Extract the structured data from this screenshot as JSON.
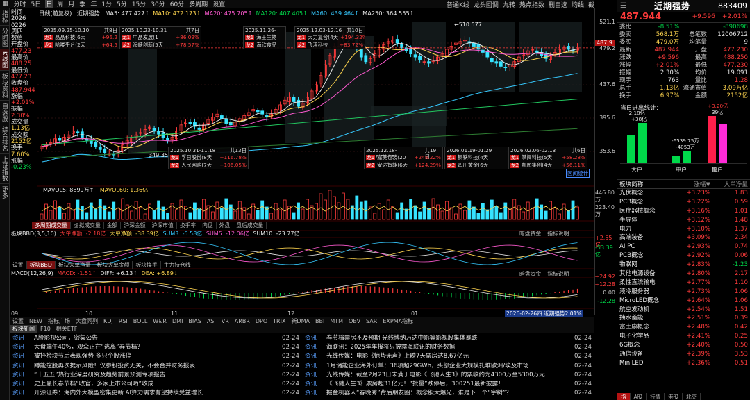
{
  "toolbar": {
    "items": [
      "分时",
      "5日",
      "日",
      "周",
      "月",
      "季",
      "年",
      "1分",
      "5分",
      "15分",
      "30分",
      "60分",
      "多周期",
      "设置"
    ],
    "selected_index": 2,
    "right_items": [
      "普通K线",
      "龙头回调",
      "九转",
      "热点指数",
      "删自选",
      "均线",
      "截"
    ]
  },
  "sidebar": [
    "指标",
    "分时图",
    "K线图",
    "板块资料",
    "自选股",
    "综合排名",
    "上证指数",
    "更多"
  ],
  "sidebar_selected": 2,
  "datacol": [
    {
      "t": "时间",
      "c": "wht"
    },
    {
      "t": "2026",
      "c": "wht"
    },
    {
      "t": "0226",
      "c": "wht"
    },
    {
      "t": "周四",
      "c": "wht"
    },
    {
      "t": "数值",
      "c": "wht"
    },
    {
      "t": "开盘价",
      "c": "wht"
    },
    {
      "t": "477.23",
      "c": "red"
    },
    {
      "t": "最高价",
      "c": "wht"
    },
    {
      "t": "488.25",
      "c": "red"
    },
    {
      "t": "最低价",
      "c": "wht"
    },
    {
      "t": "477.23",
      "c": "red"
    },
    {
      "t": "收盘价",
      "c": "wht"
    },
    {
      "t": "487.944",
      "c": "red"
    },
    {
      "t": "涨幅",
      "c": "wht"
    },
    {
      "t": "+2.01%",
      "c": "red"
    },
    {
      "t": "振幅",
      "c": "wht"
    },
    {
      "t": "2.30%",
      "c": "red"
    },
    {
      "t": "成交量",
      "c": "wht"
    },
    {
      "t": "1.13亿",
      "c": "yel"
    },
    {
      "t": "成交额",
      "c": "wht"
    },
    {
      "t": "2152亿",
      "c": "yel"
    },
    {
      "t": "换手",
      "c": "wht"
    },
    {
      "t": "7.60%",
      "c": "yel"
    },
    {
      "t": "涨幅",
      "c": "wht"
    },
    {
      "t": "-0.23%",
      "c": "grn"
    }
  ],
  "ma_header": {
    "name": "日线(前复权)",
    "stock": "近期强势",
    "items": [
      {
        "t": "MA5: 477.427↑",
        "c": "wht"
      },
      {
        "t": "MA10: 472.173↑",
        "c": "yel"
      },
      {
        "t": "MA20: 475.705↑",
        "c": "mag"
      },
      {
        "t": "MA120: 407.405↑",
        "c": "grn"
      },
      {
        "t": "MA60: 439.464↑",
        "c": "cyn"
      },
      {
        "t": "MA250: 364.555↑",
        "c": "wht"
      }
    ]
  },
  "price_scale": [
    "521.1",
    "487.9",
    "479.2",
    "437.6",
    "395.6",
    "353.6",
    "446.80万",
    "223.40万",
    "+2.55亿",
    "-53.39亿",
    "+24.92",
    "+12.28",
    "0.00",
    "-12.28"
  ],
  "current_price_tag": "487.9",
  "chart_annotations": {
    "high": "510.577",
    "low": "349.35"
  },
  "events": [
    {
      "period": "2025.09.25-10.10",
      "days": "共8日",
      "rows": [
        {
          "n": "晶晶科技(6天",
          "p": "+96.2"
        },
        {
          "n": "哈喽平台(2天",
          "p": "+64.5"
        }
      ]
    },
    {
      "period": "2025.10.23-10.31",
      "days": "共7日",
      "rows": [
        {
          "n": "中晶发展(1",
          "p": "+86.09%"
        },
        {
          "n": "海峡创新(5天",
          "p": "+78.57%"
        }
      ]
    },
    {
      "period": "2025.11.26-12.0",
      "days": "",
      "rows": [
        {
          "n": "海王生物",
          "p": ""
        },
        {
          "n": "海欣食品",
          "p": ""
        }
      ]
    },
    {
      "period": "2025.12.03-12.16",
      "days": "共10日",
      "rows": [
        {
          "n": "天力复合(4天",
          "p": "+194.32%"
        },
        {
          "n": "飞沃科技",
          "p": "+83.72%"
        }
      ]
    },
    {
      "period": "2025.10.31-11.18",
      "days": "共13日",
      "rows": [
        {
          "n": "孚日股份(8天",
          "p": "+116.78%"
        },
        {
          "n": "人民网购(7天",
          "p": "+106.05%"
        }
      ]
    },
    {
      "period": "2025.12.18-2026.01.15",
      "days": "共19日",
      "rows": [
        {
          "n": "嘉美包装(20",
          "p": "+248.22%"
        },
        {
          "n": "安达智能(6天",
          "p": "+124.29%"
        }
      ]
    },
    {
      "period": "2026.01.19-01.29",
      "days": "",
      "rows": [
        {
          "n": "钢铁科技(4天",
          "p": ""
        },
        {
          "n": "四川黄金(6天",
          "p": ""
        }
      ]
    },
    {
      "period": "2026.02.06-02.13",
      "days": "共6日",
      "rows": [
        {
          "n": "掌阅科技(5天",
          "p": "+58.28%"
        },
        {
          "n": "凯图集创(4天",
          "p": "+56.11%"
        }
      ]
    }
  ],
  "zone_label": "区间统计",
  "vol_header": {
    "name": "MAVOL5: 8899万↑",
    "ma": "MAVOL60: 1.36亿"
  },
  "vol_tabs": [
    "多周期成交量",
    "虚拟成交量",
    "金额",
    "沪深金额",
    "沪深市值",
    "换手率",
    "内盘",
    "外盘",
    "盘后成交量"
  ],
  "bbd_header": {
    "name": "板块BBD(3,5,10)",
    "a": "大单净额: -2.18亿",
    "b": "大单净额: -38.39亿",
    "c": "SUM3: -5.58亿",
    "d": "SUM5: -12.06亿",
    "e": "SUM10: -23.77亿"
  },
  "bbd_buttons": [
    "暗盘资金",
    "指标说明"
  ],
  "bbd_tabs": [
    "设置",
    "板块BBD",
    "板块大单净量",
    "板块大单金额",
    "板块换手",
    "主力持仓线"
  ],
  "macd_header": {
    "name": "MACD(12,26,9)",
    "a": "MACD: -1.51↑",
    "b": "DIFF: +6.13↑",
    "c": "DEA: +6.89↓"
  },
  "macd_buttons": [
    "暗盘资金",
    "指标说明"
  ],
  "x_axis": [
    "09",
    "10",
    "11",
    "12",
    "01"
  ],
  "date_tag": "2026-02-26四 近期强势2.01%",
  "bottom_tabs": [
    "设置",
    "NEW",
    "指标广场",
    "大盘同列",
    "KDJ",
    "RSI",
    "BOLL",
    "W&R",
    "DMI",
    "BIAS",
    "ASI",
    "VR",
    "ARBR",
    "DPO",
    "TRIX",
    "新DMA",
    "BBI",
    "MTM",
    "OBV",
    "SAR",
    "EXPMA指标"
  ],
  "news_tabs": [
    "板块新闻",
    "F10",
    "相关ETF"
  ],
  "news_left": [
    {
      "tag": "资讯",
      "t": "A股影视公司，密集公告",
      "d": "02-24"
    },
    {
      "tag": "资讯",
      "t": "大盘端午40%，观众正在“逃离”春节档？",
      "d": "02-24"
    },
    {
      "tag": "资讯",
      "t": "被抒检块节后表现强势 多只个股涨停",
      "d": "02-24"
    },
    {
      "tag": "资讯",
      "t": "蹲能控股再次提示风险！仅参股投资无关，不会合并财务报表",
      "d": "02-24"
    },
    {
      "tag": "资讯",
      "t": "“十五五”热行业深度研究及趋势前景预测专项报告",
      "d": "02-24"
    },
    {
      "tag": "资讯",
      "t": "史上最长春节档“收官，多家上市公司晒”收成",
      "d": "02-24"
    },
    {
      "tag": "资讯",
      "t": "开源证券：海内外大模型密集更新 AI算力需求有望持续受益增长",
      "d": "02-24"
    }
  ],
  "news_right": [
    {
      "tag": "资讯",
      "t": "春节档票房不及预期 光线博纳万达中影等影视股集体暴跌",
      "d": "02-24"
    },
    {
      "tag": "资讯",
      "t": "海联讯：2025年年报将只披露海联讯的财务数据",
      "d": "02-24"
    },
    {
      "tag": "资讯",
      "t": "光线传媒：电影《惊蛰无声》上映7天票房达8.67亿元",
      "d": "02-24"
    },
    {
      "tag": "资讯",
      "t": "1月储能企业海外订单：36项超29GWh，头部企业大规模扎堆欧洲/埃及市场",
      "d": "02-24"
    },
    {
      "tag": "资讯",
      "t": "光线传媒：截至2月23日未满于电影《飞驰人生3》的票收约为4300万至5300万元",
      "d": "02-24"
    },
    {
      "tag": "资讯",
      "t": "《飞驰人生3》票房超31亿元！“批量”跌停后，300251最新披露！",
      "d": "02-24"
    },
    {
      "tag": "资讯",
      "t": "掘金机器人“春晚秀”背后朋友圈：概念股大爆光，谁是下一个“宇树”？",
      "d": "02-24"
    }
  ],
  "quote": {
    "name": "近期强势",
    "code": "883409",
    "price": "487.944",
    "chg": "+9.596",
    "pct": "+2.01%",
    "rows": [
      {
        "k": "委比",
        "v1": "-8.51%",
        "c1": "grn",
        "k2": "",
        "v2": "-890698",
        "c2": "grn"
      },
      {
        "k": "委卖",
        "v1": "568.1万",
        "c1": "yel",
        "k2": "总笔数",
        "v2": "12006712",
        "c2": "wht"
      },
      {
        "k": "委买",
        "v1": "479.0万",
        "c1": "yel",
        "k2": "均笔量",
        "v2": "9",
        "c2": "wht"
      },
      {
        "k": "最新",
        "v1": "487.944",
        "c1": "red",
        "k2": "开盘",
        "v2": "477.230",
        "c2": "red"
      },
      {
        "k": "涨跌",
        "v1": "+9.596",
        "c1": "red",
        "k2": "最高",
        "v2": "488.250",
        "c2": "red"
      },
      {
        "k": "涨幅",
        "v1": "+2.01%",
        "c1": "red",
        "k2": "最低",
        "v2": "477.230",
        "c2": "red"
      },
      {
        "k": "振幅",
        "v1": "2.30%",
        "c1": "wht",
        "k2": "均价",
        "v2": "19.091",
        "c2": "wht"
      },
      {
        "k": "现手",
        "v1": "763",
        "c1": "wht",
        "k2": "量比",
        "v2": "1.28",
        "c2": "red"
      },
      {
        "k": "总手",
        "v1": "1.13亿",
        "c1": "yel",
        "k2": "流通市值",
        "v2": "3.09万亿",
        "c2": "yel"
      },
      {
        "k": "换手",
        "v1": "6.97%",
        "c1": "yel",
        "k2": "金额",
        "v2": "2152亿",
        "c2": "yel"
      }
    ]
  },
  "fund": {
    "title": "当日进出统计：",
    "bars": [
      {
        "label": "大户",
        "in": "-2.18亿",
        "out": "+38亿"
      },
      {
        "label": "中户",
        "in": "-6539.75万",
        "out": "-4053万"
      },
      {
        "label": "散户",
        "in": "+3.20亿",
        "out": "39亿"
      }
    ]
  },
  "board_tabs": [
    "板块简称",
    "涨幅▼",
    "大单净量"
  ],
  "boards": [
    {
      "n": "光伏概念",
      "c": "+3.23%",
      "f": "1.83"
    },
    {
      "n": "PCB概念",
      "c": "+3.22%",
      "f": "0.59"
    },
    {
      "n": "医疗器械概念",
      "c": "+3.16%",
      "f": "1.01"
    },
    {
      "n": "半导体",
      "c": "+3.12%",
      "f": "1.48"
    },
    {
      "n": "电力",
      "c": "+3.10%",
      "f": "1.37"
    },
    {
      "n": "高端装备",
      "c": "+3.09%",
      "f": "2.34"
    },
    {
      "n": "AI PC",
      "c": "+2.93%",
      "f": "0.74"
    },
    {
      "n": "PCB概念",
      "c": "+2.92%",
      "f": "0.06"
    },
    {
      "n": "物联网",
      "c": "+2.83%",
      "f": "-1.23"
    },
    {
      "n": "其他电源设备",
      "c": "+2.80%",
      "f": "2.17"
    },
    {
      "n": "柔性直流输电",
      "c": "+2.77%",
      "f": "1.10"
    },
    {
      "n": "液冷服务器",
      "c": "+2.73%",
      "f": "1.06"
    },
    {
      "n": "MicroLED概念",
      "c": "+2.64%",
      "f": "1.06"
    },
    {
      "n": "航空发动机",
      "c": "+2.54%",
      "f": "1.51"
    },
    {
      "n": "抽水蓄能",
      "c": "+2.51%",
      "f": "0.39"
    },
    {
      "n": "富士康概念",
      "c": "+2.48%",
      "f": "0.42"
    },
    {
      "n": "电子化学品",
      "c": "+2.41%",
      "f": "0.25"
    },
    {
      "n": "6G概念",
      "c": "+2.40%",
      "f": "0.50"
    },
    {
      "n": "通信设备",
      "c": "+2.39%",
      "f": "3.53"
    },
    {
      "n": "MiniLED",
      "c": "+2.36%",
      "f": "0.51"
    }
  ],
  "board_bottom": [
    "指",
    "A股",
    "行情",
    "港股",
    "北交"
  ]
}
